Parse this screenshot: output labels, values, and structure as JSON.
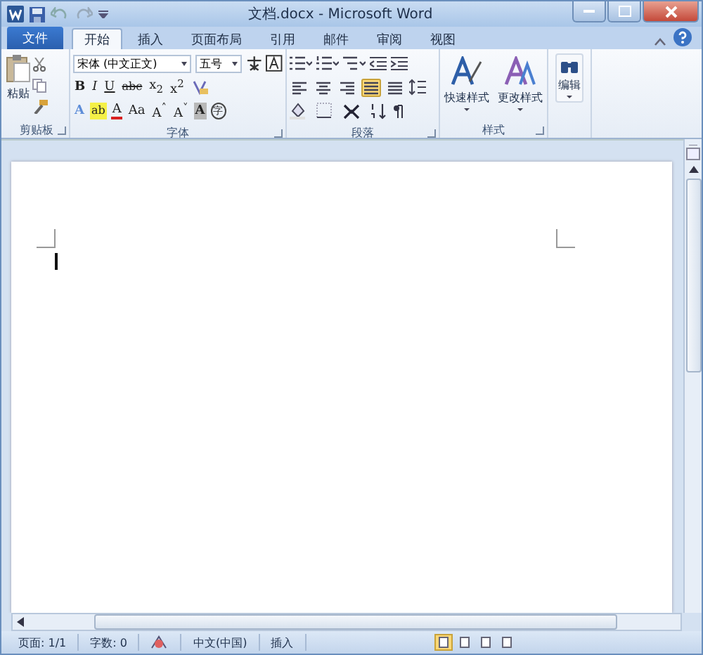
{
  "window": {
    "title": "文档.docx - Microsoft Word"
  },
  "file_tab": "文件",
  "tabs": [
    {
      "label": "开始",
      "selected": true
    },
    {
      "label": "插入",
      "selected": false
    },
    {
      "label": "页面布局",
      "selected": false
    },
    {
      "label": "引用",
      "selected": false
    },
    {
      "label": "邮件",
      "selected": false
    },
    {
      "label": "审阅",
      "selected": false
    },
    {
      "label": "视图",
      "selected": false
    }
  ],
  "clipboard": {
    "paste": "粘贴",
    "label": "剪贴板"
  },
  "font": {
    "name": "宋体 (中文正文)",
    "size": "五号",
    "label": "字体",
    "row2": [
      {
        "kind": "bold",
        "label": "B"
      },
      {
        "kind": "italic",
        "label": "I"
      },
      {
        "kind": "underline",
        "label": "U"
      },
      {
        "kind": "strike",
        "label": "abc"
      },
      {
        "kind": "plain",
        "label": "x$_{2}$"
      },
      {
        "kind": "plain",
        "label": "x$^{2}$"
      }
    ],
    "row3": [
      {
        "kind": "effects",
        "label": "A"
      },
      {
        "kind": "highlight",
        "label": "ab"
      },
      {
        "kind": "color",
        "label": "A"
      },
      {
        "kind": "plain",
        "label": "Aa"
      },
      {
        "kind": "plain",
        "label": "A$^{˄}$"
      },
      {
        "kind": "plain",
        "label": "A$^{˅}$"
      },
      {
        "kind": "shade",
        "label": "A"
      },
      {
        "kind": "enclose",
        "label": "字"
      }
    ]
  },
  "paragraph": {
    "label": "段落",
    "alignments": [
      {
        "selected": false
      },
      {
        "selected": false
      },
      {
        "selected": false
      },
      {
        "selected": true
      },
      {
        "selected": false
      }
    ]
  },
  "styles": {
    "label": "样式",
    "buttons": [
      "快速样式",
      "更改样式"
    ]
  },
  "editing": {
    "label": "编辑"
  },
  "status_bar": {
    "page": "页面: 1/1",
    "words": "字数: 0",
    "language": "中文(中国)",
    "mode": "插入",
    "views": [
      {
        "selected": true
      },
      {
        "selected": false
      },
      {
        "selected": false
      },
      {
        "selected": false
      }
    ]
  }
}
